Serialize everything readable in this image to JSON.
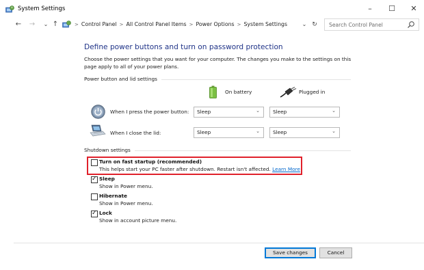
{
  "window": {
    "title": "System Settings",
    "controls": {
      "minimize": "–",
      "maximize": "☐",
      "close": "✕"
    }
  },
  "addressbar": {
    "back": "←",
    "forward": "→",
    "recent": "⌄",
    "up": "↑",
    "crumb_sep": ">",
    "breadcrumbs": [
      "Control Panel",
      "All Control Panel Items",
      "Power Options",
      "System Settings"
    ],
    "dropdown": "⌄",
    "refresh": "↻",
    "search_placeholder": "Search Control Panel"
  },
  "main": {
    "heading": "Define power buttons and turn on password protection",
    "description": "Choose the power settings that you want for your computer. The changes you make to the settings on this page apply to all of your power plans.",
    "power_section": {
      "title": "Power button and lid settings",
      "col_battery": "On battery",
      "col_plugged": "Plugged in",
      "rows": [
        {
          "label": "When I press the power button:",
          "battery": "Sleep",
          "plugged": "Sleep",
          "icon": "power-button-icon"
        },
        {
          "label": "When I close the lid:",
          "battery": "Sleep",
          "plugged": "Sleep",
          "icon": "laptop-lid-icon"
        }
      ]
    },
    "shutdown_section": {
      "title": "Shutdown settings",
      "options": [
        {
          "title": "Turn on fast startup (recommended)",
          "desc": "This helps start your PC faster after shutdown. Restart isn't affected.",
          "link": "Learn More",
          "checked": false
        },
        {
          "title": "Sleep",
          "desc": "Show in Power menu.",
          "checked": true
        },
        {
          "title": "Hibernate",
          "desc": "Show in Power menu.",
          "checked": false
        },
        {
          "title": "Lock",
          "desc": "Show in account picture menu.",
          "checked": true
        }
      ]
    }
  },
  "footer": {
    "save": "Save changes",
    "cancel": "Cancel"
  },
  "colors": {
    "heading": "#1e3287",
    "link": "#0066cc",
    "highlight": "#e0202a",
    "primary_border": "#0078d7"
  }
}
